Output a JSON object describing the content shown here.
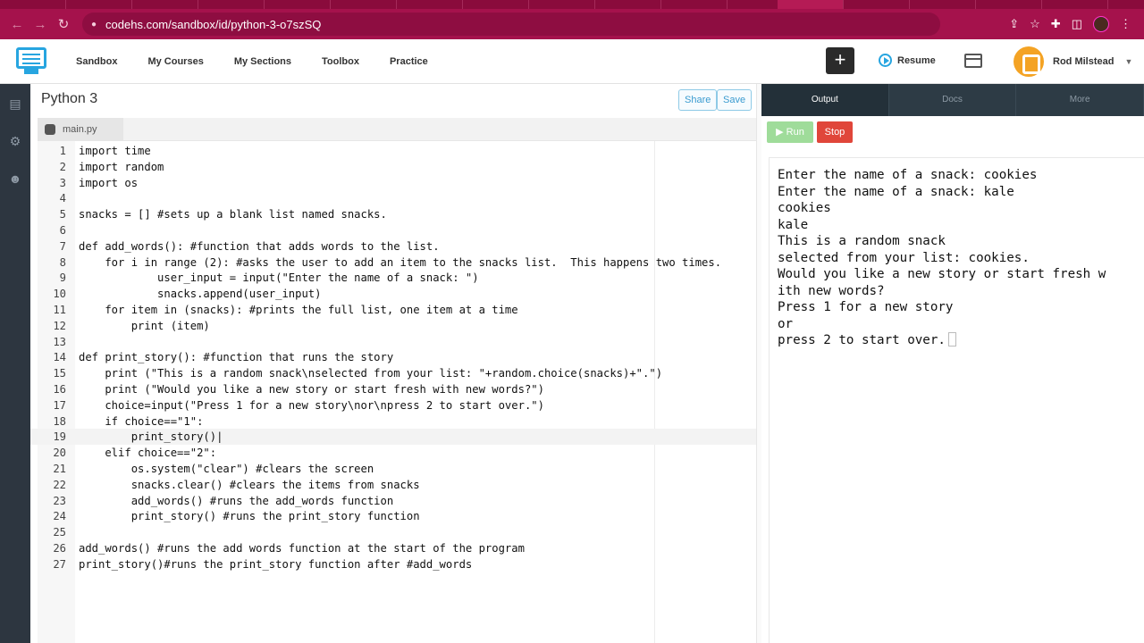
{
  "browser": {
    "url": "codehs.com/sandbox/id/python-3-o7szSQ"
  },
  "nav": {
    "items": [
      "Sandbox",
      "My Courses",
      "My Sections",
      "Toolbox",
      "Practice"
    ],
    "resume_label": "Resume",
    "user_name": "Rod Milstead"
  },
  "editor": {
    "title": "Python 3",
    "share_label": "Share",
    "save_label": "Save",
    "file_tab": "main.py",
    "active_line": 19,
    "lines": [
      {
        "n": "1",
        "code": "import time"
      },
      {
        "n": "2",
        "code": "import random"
      },
      {
        "n": "3",
        "code": "import os"
      },
      {
        "n": "4",
        "code": ""
      },
      {
        "n": "5",
        "code": "snacks = [] #sets up a blank list named snacks."
      },
      {
        "n": "6",
        "code": ""
      },
      {
        "n": "7",
        "code": "def add_words(): #function that adds words to the list."
      },
      {
        "n": "8",
        "code": "    for i in range (2): #asks the user to add an item to the snacks list.  This happens two times."
      },
      {
        "n": "9",
        "code": "            user_input = input(\"Enter the name of a snack: \")"
      },
      {
        "n": "10",
        "code": "            snacks.append(user_input)"
      },
      {
        "n": "11",
        "code": "    for item in (snacks): #prints the full list, one item at a time"
      },
      {
        "n": "12",
        "code": "        print (item)"
      },
      {
        "n": "13",
        "code": ""
      },
      {
        "n": "14",
        "code": "def print_story(): #function that runs the story"
      },
      {
        "n": "15",
        "code": "    print (\"This is a random snack\\nselected from your list: \"+random.choice(snacks)+\".\")"
      },
      {
        "n": "16",
        "code": "    print (\"Would you like a new story or start fresh with new words?\")"
      },
      {
        "n": "17",
        "code": "    choice=input(\"Press 1 for a new story\\nor\\npress 2 to start over.\")"
      },
      {
        "n": "18",
        "code": "    if choice==\"1\":"
      },
      {
        "n": "19",
        "code": "        print_story()|"
      },
      {
        "n": "20",
        "code": "    elif choice==\"2\":"
      },
      {
        "n": "21",
        "code": "        os.system(\"clear\") #clears the screen"
      },
      {
        "n": "22",
        "code": "        snacks.clear() #clears the items from snacks"
      },
      {
        "n": "23",
        "code": "        add_words() #runs the add_words function"
      },
      {
        "n": "24",
        "code": "        print_story() #runs the print_story function"
      },
      {
        "n": "25",
        "code": ""
      },
      {
        "n": "26",
        "code": "add_words() #runs the add words function at the start of the program"
      },
      {
        "n": "27",
        "code": "print_story()#runs the print_story function after #add_words"
      }
    ]
  },
  "output": {
    "tabs": [
      "Output",
      "Docs",
      "More"
    ],
    "run_label": "Run",
    "stop_label": "Stop",
    "console": "Enter the name of a snack: cookies\nEnter the name of a snack: kale\ncookies\nkale\nThis is a random snack\nselected from your list: cookies.\nWould you like a new story or start fresh w\nith new words?\nPress 1 for a new story\nor\npress 2 to start over."
  }
}
